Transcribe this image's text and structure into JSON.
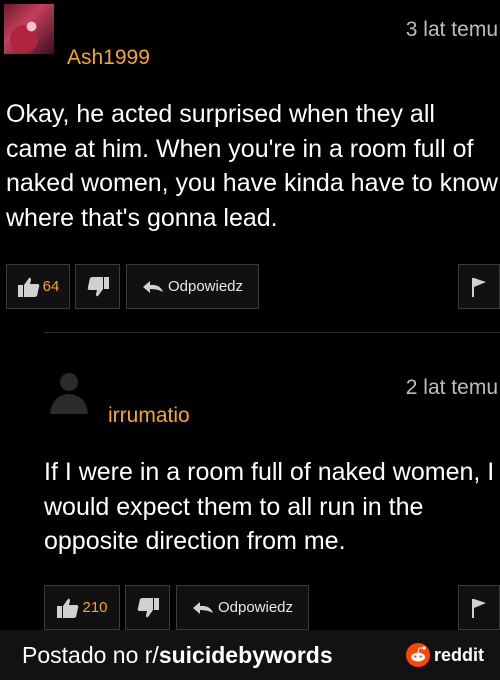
{
  "comments": [
    {
      "username": "Ash1999",
      "timestamp": "3 lat temu",
      "lines": [
        "Okay, he acted surprised when they all",
        "came at him. When you're in a room full of",
        "naked women, you have kinda have to know",
        "where that's gonna lead."
      ],
      "upvotes": "64",
      "reply_label": "Odpowiedz"
    },
    {
      "username": "irrumatio",
      "timestamp": "2 lat temu",
      "lines": [
        "If I were in a room full of naked women, I",
        "would expect them to all run in the",
        "opposite direction from me."
      ],
      "upvotes": "210",
      "reply_label": "Odpowiedz"
    }
  ],
  "footer": {
    "prefix": "Postado no r/",
    "subreddit": "suicidebywords",
    "brand": "reddit"
  },
  "colors": {
    "background": "#000000",
    "username": "#f6a623",
    "footer_bg": "#121212",
    "reddit_orange": "#ff4500"
  }
}
